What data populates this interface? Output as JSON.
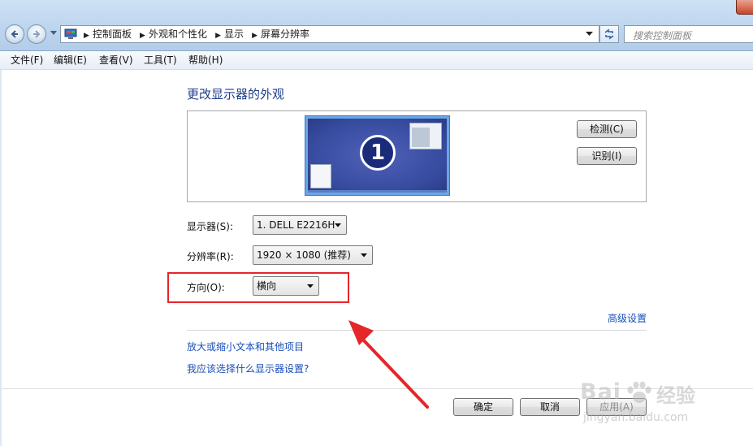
{
  "address_bar": {
    "breadcrumbs": [
      "控制面板",
      "外观和个性化",
      "显示",
      "屏幕分辨率"
    ]
  },
  "search": {
    "placeholder": "搜索控制面板"
  },
  "menu": [
    "文件(F)",
    "编辑(E)",
    "查看(V)",
    "工具(T)",
    "帮助(H)"
  ],
  "main": {
    "title": "更改显示器的外观",
    "monitor_number": "1",
    "detect_label": "检测(C)",
    "identify_label": "识别(I)",
    "display_label": "显示器(S):",
    "display_value": "1. DELL E2216H",
    "resolution_label": "分辨率(R):",
    "resolution_value": "1920 × 1080 (推荐)",
    "orientation_label": "方向(O):",
    "orientation_value": "横向",
    "advanced_link": "高级设置",
    "text_size_link": "放大或缩小文本和其他项目",
    "which_settings_link": "我应该选择什么显示器设置?"
  },
  "buttons": {
    "ok": "确定",
    "cancel": "取消",
    "apply": "应用(A)"
  },
  "watermark": {
    "brand": "Bai",
    "product": "经验",
    "url": "jingyan.baidu.com"
  },
  "colors": {
    "annotation": "#e5262a",
    "link": "#1a4eb8",
    "title": "#1e3e8a"
  }
}
